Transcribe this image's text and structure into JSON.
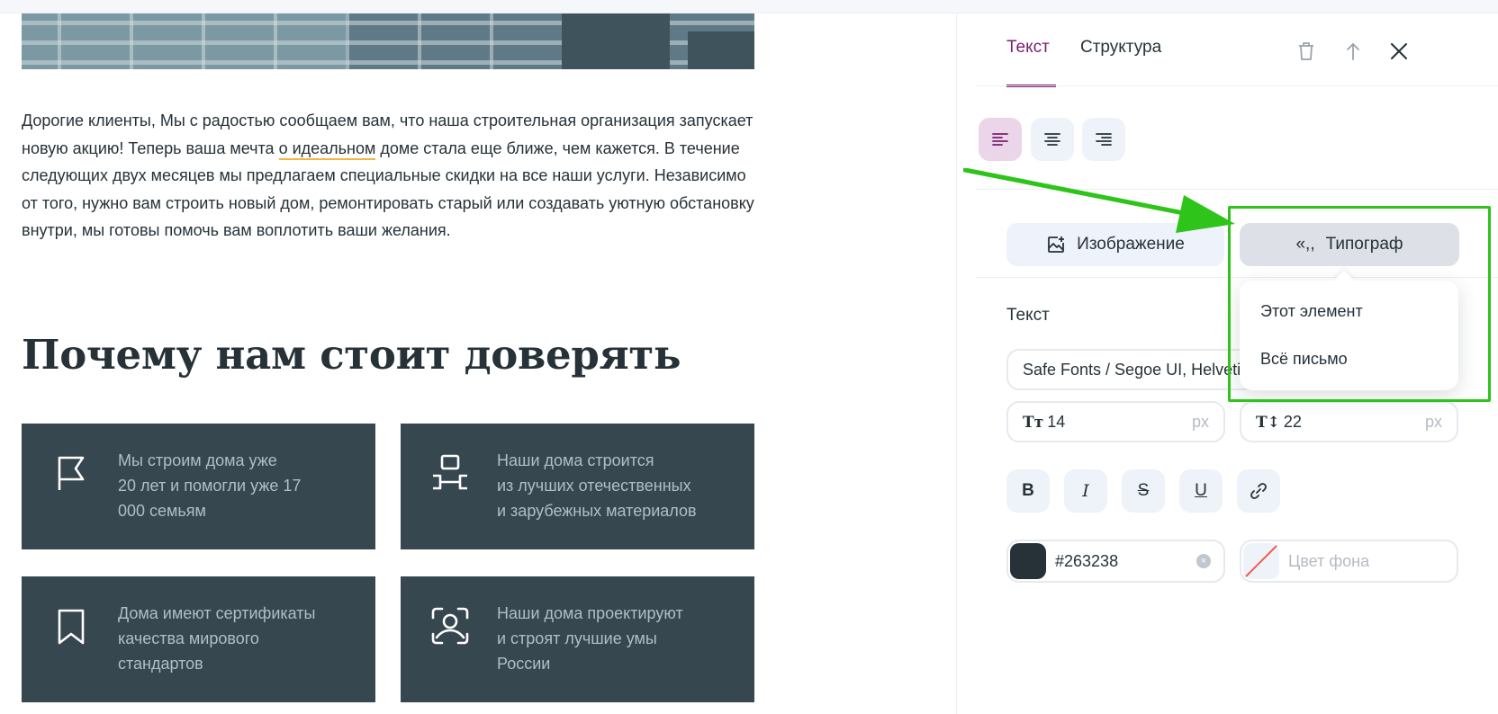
{
  "email": {
    "paragraph": {
      "before": "Дорогие клиенты, Мы с радостью сообщаем вам, что наша строительная организация запускает новую акцию! Теперь ваша мечта ",
      "underlined": "о идеальном",
      "after": " доме стала еще ближе, чем кажется. В течение следующих двух месяцев мы предлагаем специальные скидки на все наши услуги. Независимо от того, нужно вам строить новый дом, ремонтировать старый или создавать уютную обстановку внутри, мы готовы помочь вам воплотить ваши желания."
    },
    "heading": "Почему нам стоит доверять",
    "cards": [
      {
        "icon": "flag-icon",
        "text": "Мы строим дома уже\n20 лет и помогли уже 17\n000 семьям"
      },
      {
        "icon": "structure-icon",
        "text": "Наши дома строится\nиз лучших отечественных\nи зарубежных материалов"
      },
      {
        "icon": "bookmark-icon",
        "text": "Дома имеют сертификаты\nкачества мирового\nстандартов"
      },
      {
        "icon": "face-scan-icon",
        "text": "Наши дома проектируют\nи строят лучшие умы\nРоссии"
      }
    ],
    "card_color": "#37474f"
  },
  "panel": {
    "tabs": [
      {
        "label": "Текст",
        "active": true
      },
      {
        "label": "Структура",
        "active": false
      }
    ],
    "header_icons": [
      "trash-icon",
      "move-up-icon",
      "close-icon"
    ],
    "align_buttons": [
      "align-left-icon",
      "align-center-icon",
      "align-right-icon"
    ],
    "image_button": "Изображение",
    "typograph_button": "Типограф",
    "typograph_menu": [
      "Этот элемент",
      "Всё письмо"
    ],
    "text_section_label": "Текст",
    "font_value": "Safe Fonts / Segoe UI, Helvetica",
    "font_size": {
      "prefix": "Tт",
      "value": "14",
      "unit": "px"
    },
    "line_height": {
      "prefix": "T↕",
      "value": "22",
      "unit": "px"
    },
    "format_buttons": [
      "B",
      "I",
      "S",
      "U",
      "link-icon"
    ],
    "text_color": "#263238",
    "bg_color_placeholder": "Цвет фона",
    "accent_color": "#7b1f6f",
    "annotation_color": "#2ec41a"
  }
}
